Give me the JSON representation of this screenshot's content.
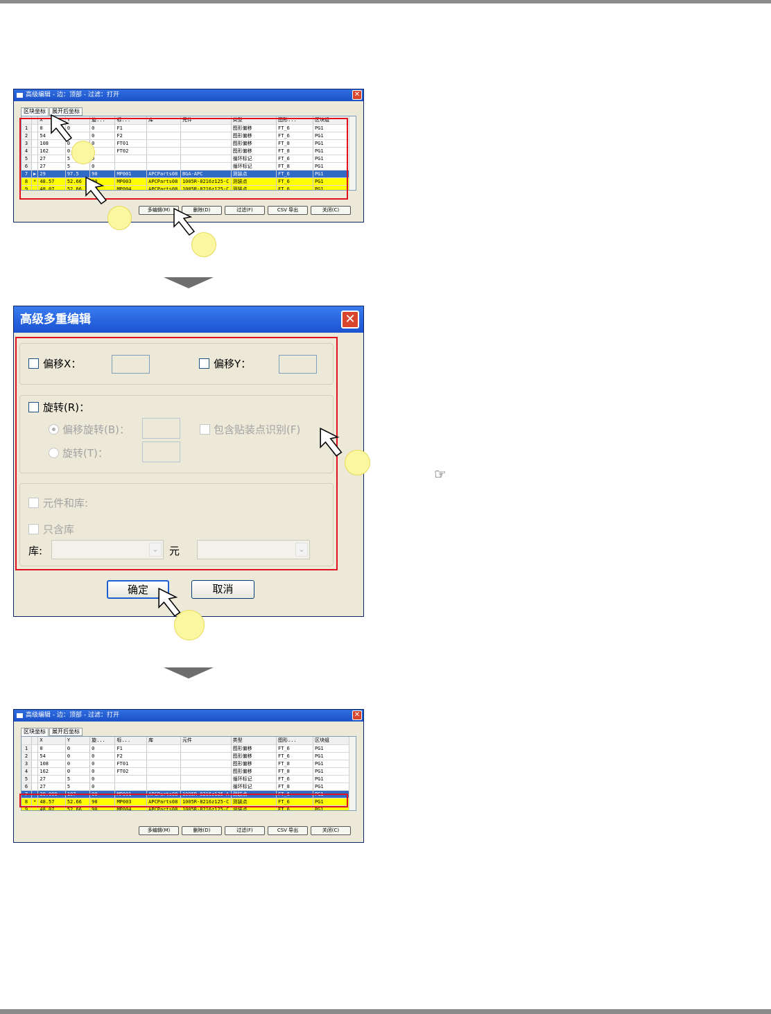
{
  "window1": {
    "title": "高级编辑 - 边：顶部 - 过滤：打开",
    "tabs": [
      "区块坐标",
      "展开后坐标"
    ],
    "columns": [
      "",
      "",
      "X",
      "Y",
      "旋...",
      "标...",
      "库",
      "元件",
      "类型",
      "图形...",
      "区块组"
    ],
    "rows": [
      {
        "n": "1",
        "m": "",
        "x": "0",
        "y": "0",
        "r": "0",
        "ref": "F1",
        "lib": "",
        "part": "",
        "type": "图形偏移",
        "shape": "FT_6",
        "grp": "PG1"
      },
      {
        "n": "2",
        "m": "",
        "x": "54",
        "y": "0",
        "r": "0",
        "ref": "F2",
        "lib": "",
        "part": "",
        "type": "图形偏移",
        "shape": "FT_6",
        "grp": "PG1"
      },
      {
        "n": "3",
        "m": "",
        "x": "108",
        "y": "0",
        "r": "0",
        "ref": "FT01",
        "lib": "",
        "part": "",
        "type": "图形偏移",
        "shape": "FT_8",
        "grp": "PG1"
      },
      {
        "n": "4",
        "m": "",
        "x": "162",
        "y": "0",
        "r": "0",
        "ref": "FT02",
        "lib": "",
        "part": "",
        "type": "图形偏移",
        "shape": "FT_8",
        "grp": "PG1"
      },
      {
        "n": "5",
        "m": "",
        "x": "27",
        "y": "5",
        "r": "0",
        "ref": "",
        "lib": "",
        "part": "",
        "type": "循环标记",
        "shape": "FT_6",
        "grp": "PG1"
      },
      {
        "n": "6",
        "m": "",
        "x": "27",
        "y": "5",
        "r": "0",
        "ref": "",
        "lib": "",
        "part": "",
        "type": "循环标记",
        "shape": "FT_8",
        "grp": "PG1"
      },
      {
        "n": "7",
        "m": "▶",
        "x": "29",
        "y": "97.5",
        "r": "90",
        "ref": "MP001",
        "lib": "APCParts08",
        "part": "BGA-APC",
        "type": "测装点",
        "shape": "FT_6",
        "grp": "PG1"
      },
      {
        "n": "8",
        "m": "*",
        "x": "48.57",
        "y": "52.66",
        "r": "90",
        "ref": "MP003",
        "lib": "APCParts08",
        "part": "1005R-8216z125-C",
        "type": "测装点",
        "shape": "FT_6",
        "grp": "PG1"
      },
      {
        "n": "9",
        "m": "",
        "x": "48.07",
        "y": "52.66",
        "r": "90",
        "ref": "MP004",
        "lib": "APCParts08",
        "part": "1005R-8216z125-C",
        "type": "测装点",
        "shape": "FT_6",
        "grp": "PG1"
      }
    ],
    "buttons": [
      "多编辑(M)",
      "删除(D)",
      "过滤(F)",
      "CSV 导出",
      "关闭(C)"
    ]
  },
  "dialog": {
    "title": "高级多重编辑",
    "offset_x_label": "偏移X：",
    "offset_y_label": "偏移Y：",
    "rotation_label": "旋转(R)：",
    "offset_rotation_label": "偏移旋转(B)：",
    "include_mark_label": "包含贴装点识别(F)",
    "rotate_label": "旋转(T)：",
    "parts_lib_label": "元件和库:",
    "lib_only_label": "只含库",
    "lib_label": "库:",
    "part_label": "元",
    "ok_label": "确定",
    "cancel_label": "取消"
  },
  "window3": {
    "title": "高级编辑 - 边：顶部 - 过滤：打开",
    "tabs": [
      "区块坐标",
      "展开后坐标"
    ],
    "columns": [
      "",
      "",
      "X",
      "Y",
      "旋...",
      "标...",
      "库",
      "元件",
      "类型",
      "图形...",
      "区块组"
    ],
    "rows": [
      {
        "n": "1",
        "m": "",
        "x": "0",
        "y": "0",
        "r": "0",
        "ref": "F1",
        "lib": "",
        "part": "",
        "type": "图形偏移",
        "shape": "FT_6",
        "grp": "PG1"
      },
      {
        "n": "2",
        "m": "",
        "x": "54",
        "y": "0",
        "r": "0",
        "ref": "F2",
        "lib": "",
        "part": "",
        "type": "图形偏移",
        "shape": "FT_6",
        "grp": "PG1"
      },
      {
        "n": "3",
        "m": "",
        "x": "108",
        "y": "0",
        "r": "0",
        "ref": "FT01",
        "lib": "",
        "part": "",
        "type": "图形偏移",
        "shape": "FT_8",
        "grp": "PG1"
      },
      {
        "n": "4",
        "m": "",
        "x": "162",
        "y": "0",
        "r": "0",
        "ref": "FT02",
        "lib": "",
        "part": "",
        "type": "图形偏移",
        "shape": "FT_8",
        "grp": "PG1"
      },
      {
        "n": "5",
        "m": "",
        "x": "27",
        "y": "5",
        "r": "0",
        "ref": "",
        "lib": "",
        "part": "",
        "type": "循环标记",
        "shape": "FT_6",
        "grp": "PG1"
      },
      {
        "n": "6",
        "m": "",
        "x": "27",
        "y": "5",
        "r": "0",
        "ref": "",
        "lib": "",
        "part": "",
        "type": "循环标记",
        "shape": "FT_8",
        "grp": "PG1"
      },
      {
        "n": "7",
        "m": "",
        "x": "39.000",
        "y": "107",
        "r": "90",
        "ref": "MP001",
        "lib": "APCParts08",
        "part": "1005R-8216z125-A",
        "type": "测装点",
        "shape": "FT_6",
        "grp": "PG1"
      },
      {
        "n": "8",
        "m": "*",
        "x": "48.57",
        "y": "52.66",
        "r": "90",
        "ref": "MP003",
        "lib": "APCParts08",
        "part": "1005R-8216z125-C",
        "type": "测装点",
        "shape": "FT_6",
        "grp": "PG1"
      },
      {
        "n": "9",
        "m": "",
        "x": "48.07",
        "y": "52.66",
        "r": "90",
        "ref": "MP004",
        "lib": "APCParts08",
        "part": "1005R-8216z125-C",
        "type": "测装点",
        "shape": "FT_6",
        "grp": "PG1"
      }
    ],
    "buttons": [
      "多编辑(M)",
      "删除(D)",
      "过滤(F)",
      "CSV 导出",
      "关闭(C)"
    ]
  },
  "icons": {
    "reference": "pointing-hand-icon"
  },
  "colors": {
    "highlight": "#e0101e",
    "callout": "#fbf7a0",
    "selection": "#316ac5"
  }
}
